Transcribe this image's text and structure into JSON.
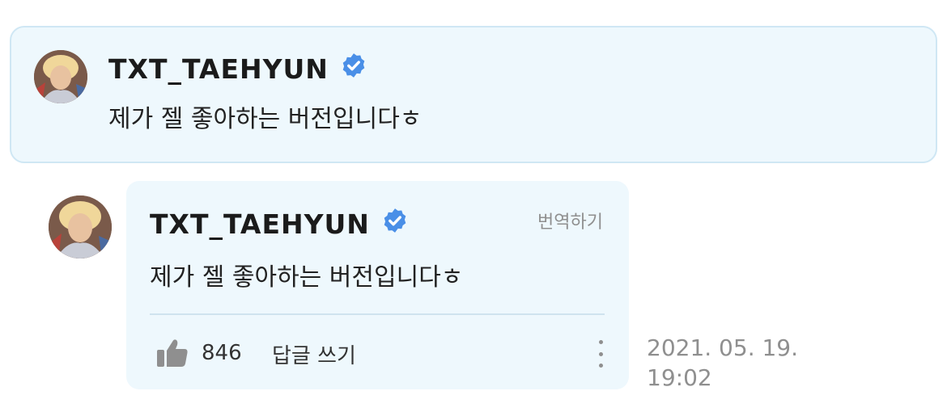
{
  "highlighted_comment": {
    "author": "TXT_TAEHYUN",
    "verified": true,
    "text": "제가 젤 좋아하는 버전입니다ㅎ"
  },
  "reply": {
    "author": "TXT_TAEHYUN",
    "verified": true,
    "translate_label": "번역하기",
    "text": "제가 젤 좋아하는 버전입니다ㅎ",
    "like_count": "846",
    "reply_label": "답글 쓰기",
    "date": "2021. 05. 19.",
    "time": "19:02"
  },
  "colors": {
    "card_bg": "#eef8fd",
    "card_border": "#cfe7f4",
    "verified_badge": "#4a8fe7",
    "muted_text": "#8f8f8f"
  },
  "icons": {
    "verified": "verified-badge-icon",
    "like": "thumbs-up-icon",
    "more": "more-vertical-icon"
  }
}
